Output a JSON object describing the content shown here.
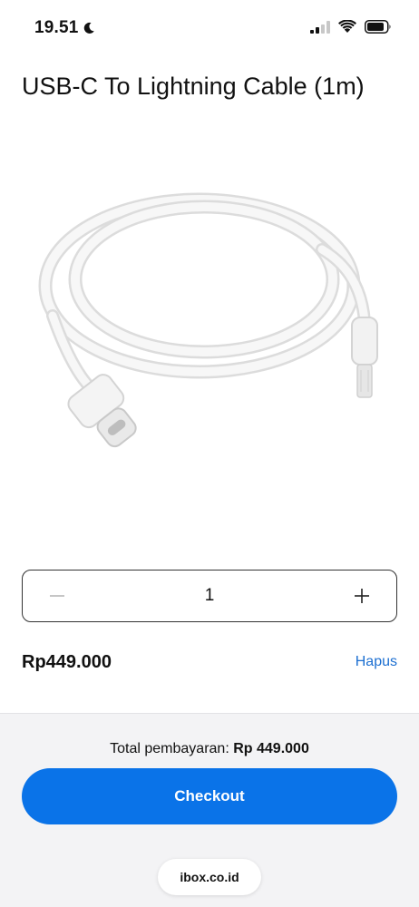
{
  "status_bar": {
    "time": "19.51",
    "icons": [
      "moon-icon",
      "cellular-signal-icon",
      "wifi-icon",
      "battery-icon"
    ]
  },
  "product": {
    "title": "USB-C To Lightning Cable (1m)",
    "image_icon": "usb-c-lightning-cable-image"
  },
  "quantity": {
    "value": "1",
    "decrement_icon": "minus-icon",
    "increment_icon": "plus-icon"
  },
  "line_item": {
    "price": "Rp449.000",
    "remove_label": "Hapus"
  },
  "checkout": {
    "total_label": "Total pembayaran:",
    "total_amount": "Rp 449.000",
    "button_label": "Checkout"
  },
  "browser": {
    "url": "ibox.co.id"
  },
  "colors": {
    "accent": "#0a73e8",
    "link": "#1c6fd1",
    "panel_bg": "#f3f3f5"
  }
}
